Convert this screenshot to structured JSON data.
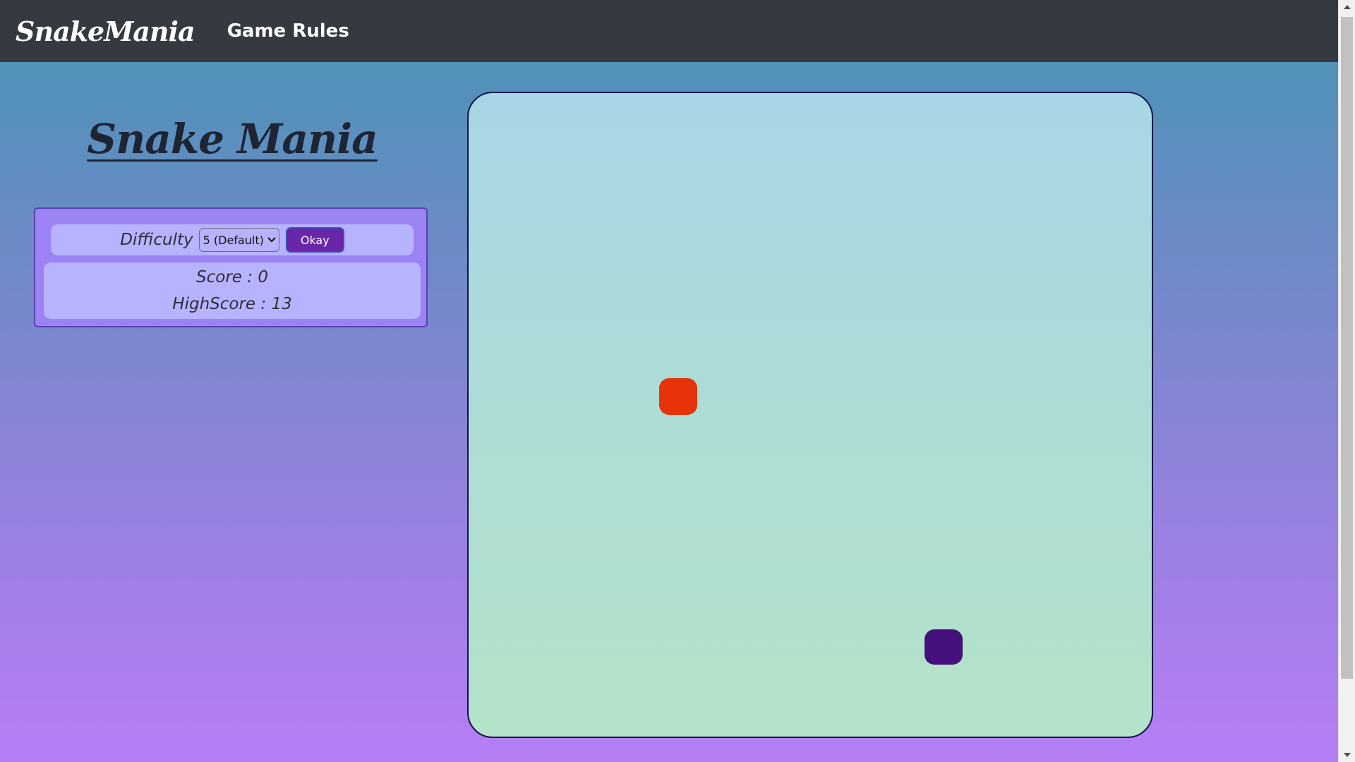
{
  "navbar": {
    "brand": "SnakeMania",
    "link_game_rules": "Game Rules"
  },
  "sidebar": {
    "title": "Snake Mania",
    "difficulty_label": "Difficulty",
    "difficulty_value": "5 (Default)",
    "okay_label": "Okay",
    "score_text": "Score : 0",
    "highscore_text": "HighScore : 13"
  },
  "game": {
    "score": 0,
    "highscore": 13,
    "difficulty": 5
  },
  "colors": {
    "navbar": "#343a40",
    "food": "#e63309",
    "snake": "#44117a",
    "board_top": "#a8d6e6",
    "board_bottom": "#b3e3c7",
    "okay_button": "#6a26a8",
    "panel": "#9b83f3"
  },
  "icons": {
    "select_arrow": "chevron-down-icon",
    "scroll_up": "scroll-up-arrow-icon",
    "scroll_down": "scroll-down-arrow-icon"
  }
}
